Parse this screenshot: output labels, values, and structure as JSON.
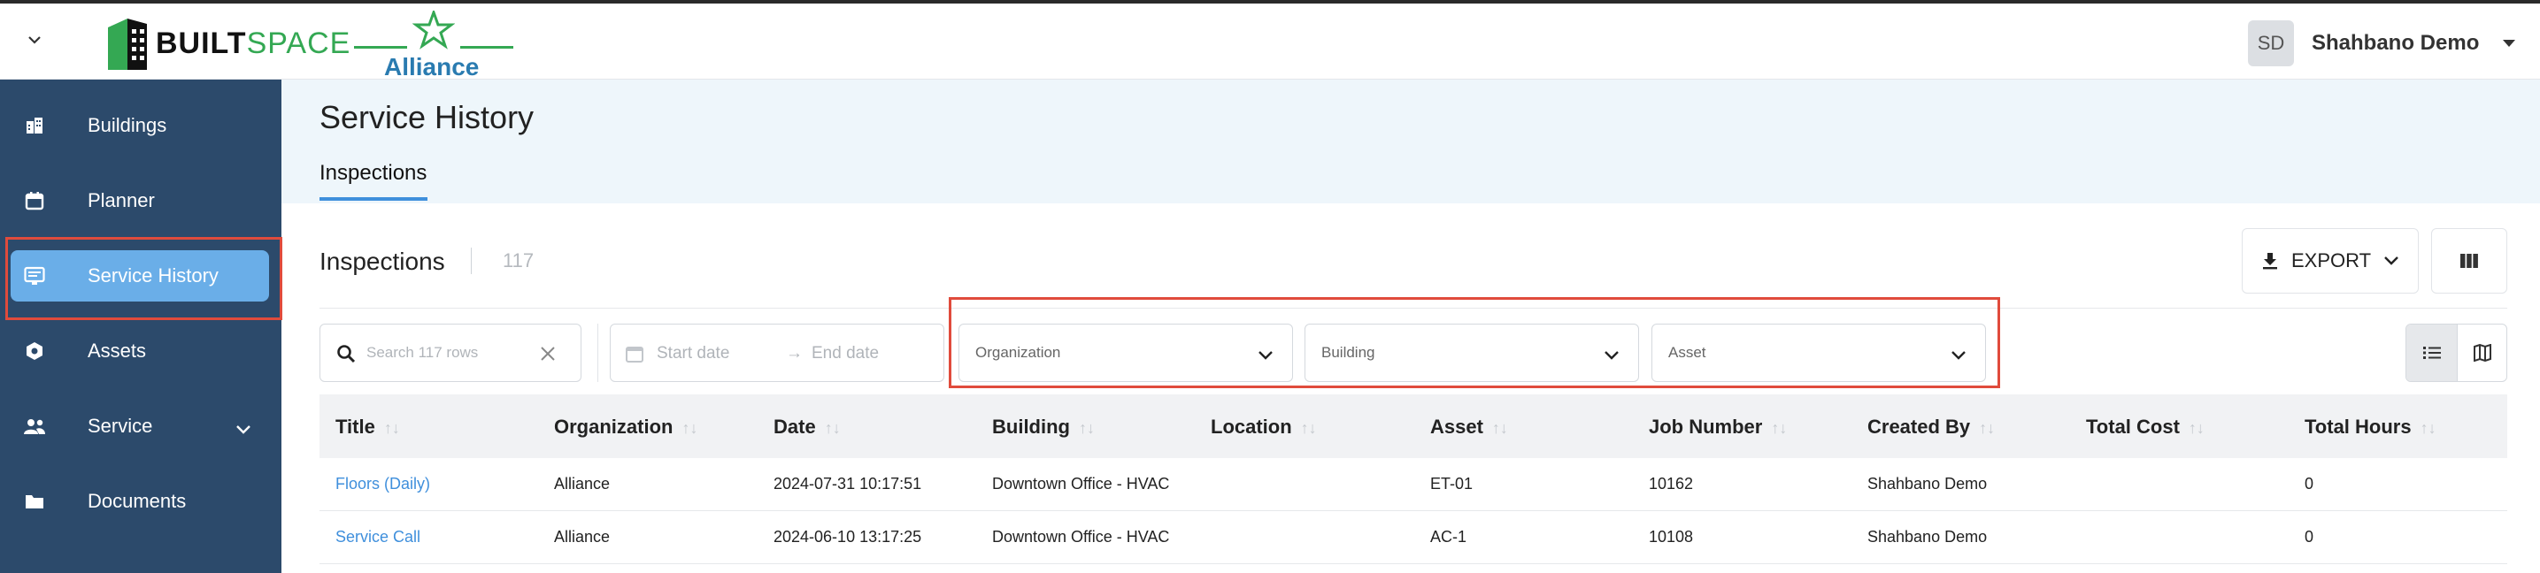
{
  "topbar": {
    "logo_builtspace_main": "BUILT",
    "logo_builtspace_accent": "SPACE",
    "logo_alliance": "Alliance",
    "user_initials": "SD",
    "user_name": "Shahbano Demo"
  },
  "sidebar": {
    "items": [
      {
        "label": "Buildings",
        "icon": "buildings-icon"
      },
      {
        "label": "Planner",
        "icon": "calendar-icon"
      },
      {
        "label": "Service History",
        "icon": "list-icon",
        "active": true
      },
      {
        "label": "Assets",
        "icon": "hexagon-icon"
      },
      {
        "label": "Service",
        "icon": "people-icon",
        "expandable": true
      },
      {
        "label": "Documents",
        "icon": "folder-icon"
      }
    ]
  },
  "page": {
    "title": "Service History",
    "tab": "Inspections"
  },
  "section": {
    "title": "Inspections",
    "count": "117"
  },
  "toolbar": {
    "export_label": "EXPORT"
  },
  "filters": {
    "search_placeholder": "Search 117 rows",
    "start_date": "Start date",
    "end_date": "End date",
    "date_arrow": "→",
    "organization": "Organization",
    "building": "Building",
    "asset": "Asset"
  },
  "table": {
    "columns": [
      "Title",
      "Organization",
      "Date",
      "Building",
      "Location",
      "Asset",
      "Job Number",
      "Created By",
      "Total Cost",
      "Total Hours"
    ],
    "sort_glyph": "↑↓",
    "rows": [
      [
        "Floors (Daily)",
        "Alliance",
        "2024-07-31 10:17:51",
        "Downtown Office - HVAC",
        "",
        "ET-01",
        "10162",
        "Shahbano Demo",
        "",
        "0"
      ],
      [
        "Service Call",
        "Alliance",
        "2024-06-10 13:17:25",
        "Downtown Office - HVAC",
        "",
        "AC-1",
        "10108",
        "Shahbano Demo",
        "",
        "0"
      ]
    ]
  },
  "colors": {
    "sidebar_bg": "#2c4a6b",
    "active_pill": "#6aaee8",
    "accent": "#3f8fdc",
    "highlight_red": "#e04b3c",
    "header_band": "#eef6fb"
  }
}
